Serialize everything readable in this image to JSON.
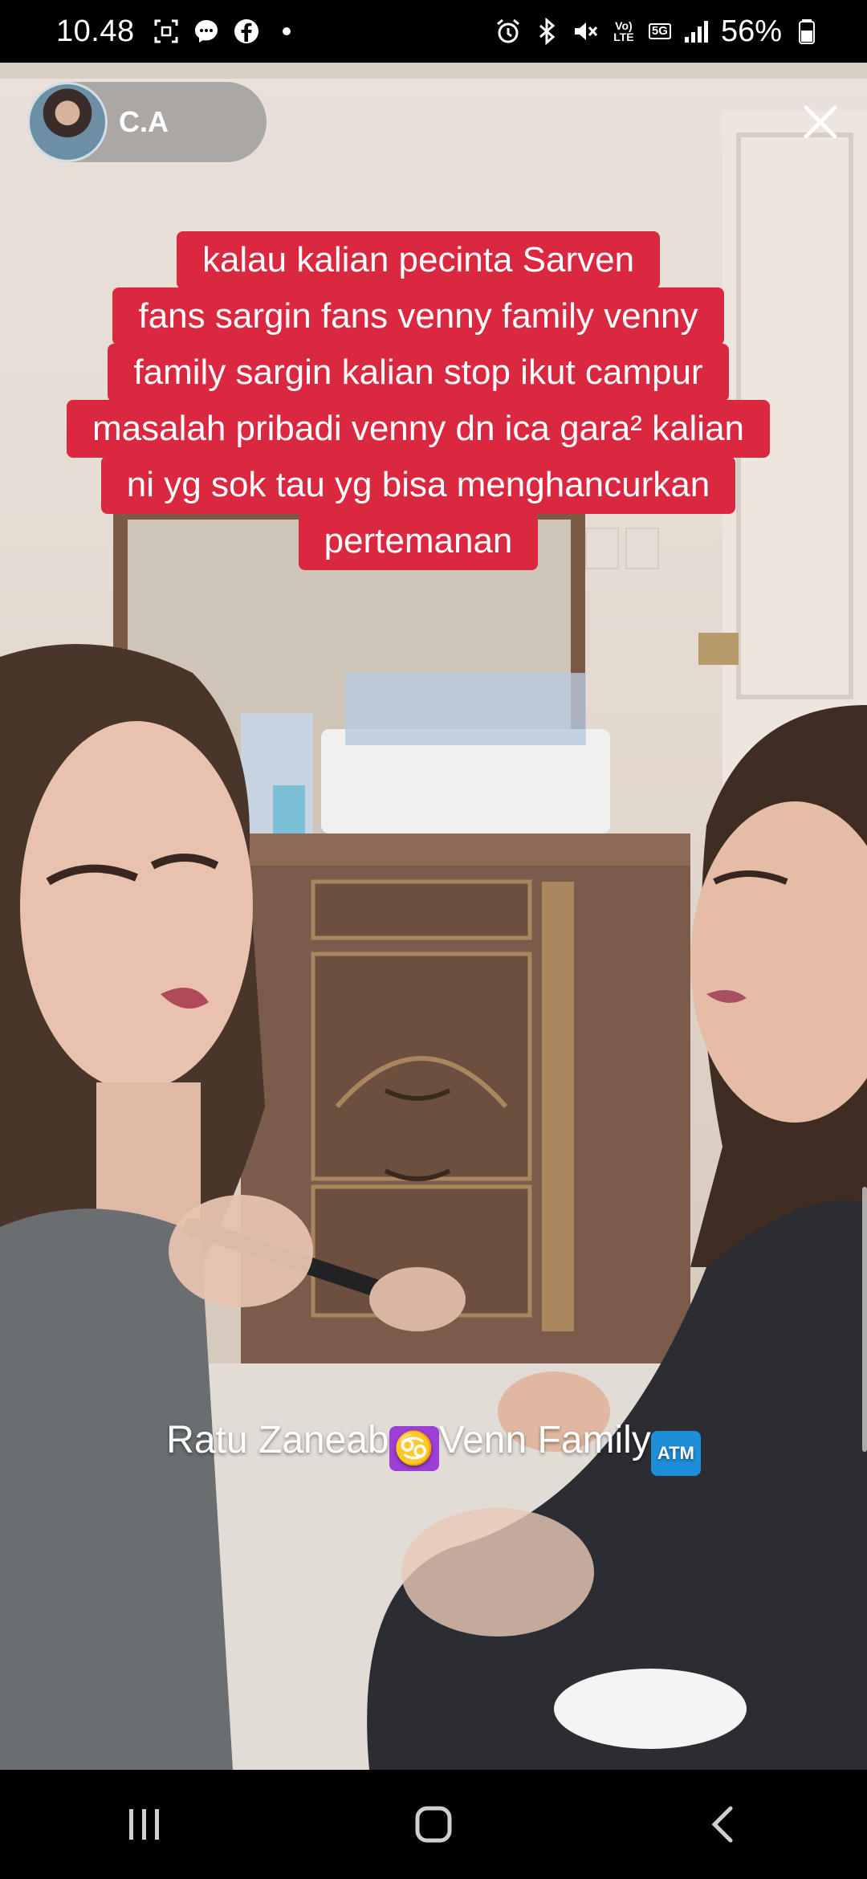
{
  "status_bar": {
    "time": "10.48",
    "left_icons": [
      "screenshot-icon",
      "messenger-icon",
      "facebook-icon",
      "notification-dot-icon"
    ],
    "right_icons": [
      "alarm-icon",
      "bluetooth-icon",
      "mute-icon",
      "volte-icon",
      "5g-icon",
      "signal-icon",
      "battery-icon"
    ],
    "volte_label": "Vo) LTE",
    "network_label": "5G",
    "battery": "56%"
  },
  "story": {
    "username": "C.A",
    "caption_lines": [
      "kalau kalian pecinta Sarven",
      "fans sargin fans venny family venny",
      "family sargin kalian stop ikut campur",
      "masalah pribadi venny dn ica gara² kalian",
      "ni yg sok tau yg bisa menghancurkan",
      "pertemanan"
    ],
    "overlay_text_part1": "Ratu Zaneab",
    "overlay_emoji1": "♋",
    "overlay_text_part2": "Venn Family",
    "overlay_emoji2": "ATM"
  },
  "colors": {
    "caption_bg": "#d9283f",
    "status_bg": "#000000",
    "chip_bg": "#787878"
  },
  "nav_bar": {
    "buttons": [
      "recents-icon",
      "home-icon",
      "back-icon"
    ]
  }
}
